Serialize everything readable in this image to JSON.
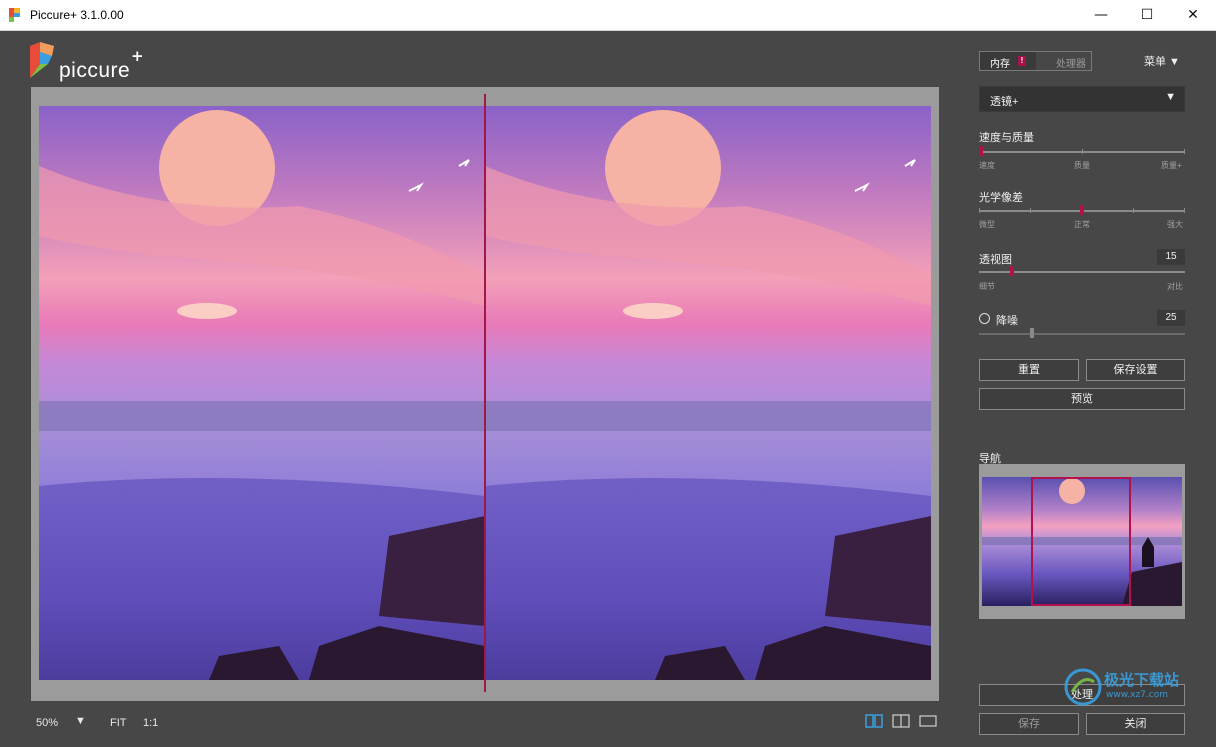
{
  "window": {
    "title": "Piccure+ 3.1.0.00",
    "minimize": "—",
    "maximize": "☐",
    "close": "✕"
  },
  "logo": {
    "text": "piccure",
    "plus": "+"
  },
  "toolbar": {
    "zoom": "50%",
    "zoom_arrow": "▼",
    "fit": "FIT",
    "one_to_one": "1:1"
  },
  "sidebar": {
    "toggle": {
      "memory": "内存",
      "warning": "!",
      "processor": "处理器"
    },
    "menu": "菜单 ▼",
    "lens_select": {
      "value": "透镜+",
      "arrow": "▼"
    },
    "speed_quality": {
      "label": "速度与质量",
      "ticks": [
        "速度",
        "质量",
        "质量+"
      ],
      "value_fraction": 0.0
    },
    "optical_aberration": {
      "label": "光学像差",
      "ticks": [
        "微型",
        "正常",
        "强大"
      ],
      "value_fraction": 0.5
    },
    "perspective": {
      "label": "透视图",
      "value": "15",
      "ticks": [
        "细节",
        "对比"
      ],
      "value_fraction": 0.15
    },
    "denoise": {
      "label": "降噪",
      "value": "25",
      "value_fraction": 0.25
    },
    "buttons": {
      "reset": "重置",
      "save_settings": "保存设置",
      "preview": "预览",
      "process": "处理",
      "save": "保存",
      "close": "关闭"
    },
    "navigation_label": "导航"
  },
  "watermark": {
    "text": "极光下载站",
    "sub": "www.xz7.com"
  },
  "colors": {
    "accent": "#b1124e",
    "background": "#474747",
    "frame": "#9b9b9b"
  }
}
